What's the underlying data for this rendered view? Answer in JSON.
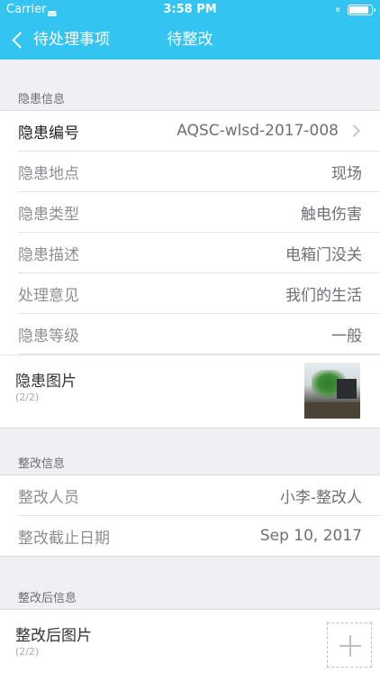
{
  "status_bar": {
    "carrier": "Carrier",
    "time": "3:58 PM"
  },
  "nav": {
    "back_label": "待处理事项",
    "title": "待整改"
  },
  "hazard_section": {
    "header": "隐患信息",
    "rows": [
      {
        "label": "隐患编号",
        "value": "AQSC-wlsd-2017-008"
      },
      {
        "label": "隐患地点",
        "value": "现场"
      },
      {
        "label": "隐患类型",
        "value": "触电伤害"
      },
      {
        "label": "隐患描述",
        "value": "电箱门没关"
      },
      {
        "label": "处理意见",
        "value": "我们的生活"
      },
      {
        "label": "隐患等级",
        "value": "一般"
      }
    ],
    "images": {
      "label": "隐患图片",
      "count": "(2/2)"
    }
  },
  "rectify_section": {
    "header": "整改信息",
    "rows": [
      {
        "label": "整改人员",
        "value": "小李-整改人"
      },
      {
        "label": "整改截止日期",
        "value": "Sep 10, 2017"
      }
    ]
  },
  "after_section": {
    "header": "整改后信息",
    "images": {
      "label": "整改后图片",
      "count": "(2/2)"
    }
  },
  "colors": {
    "accent": "#33c4f2",
    "background": "#efeff4"
  }
}
